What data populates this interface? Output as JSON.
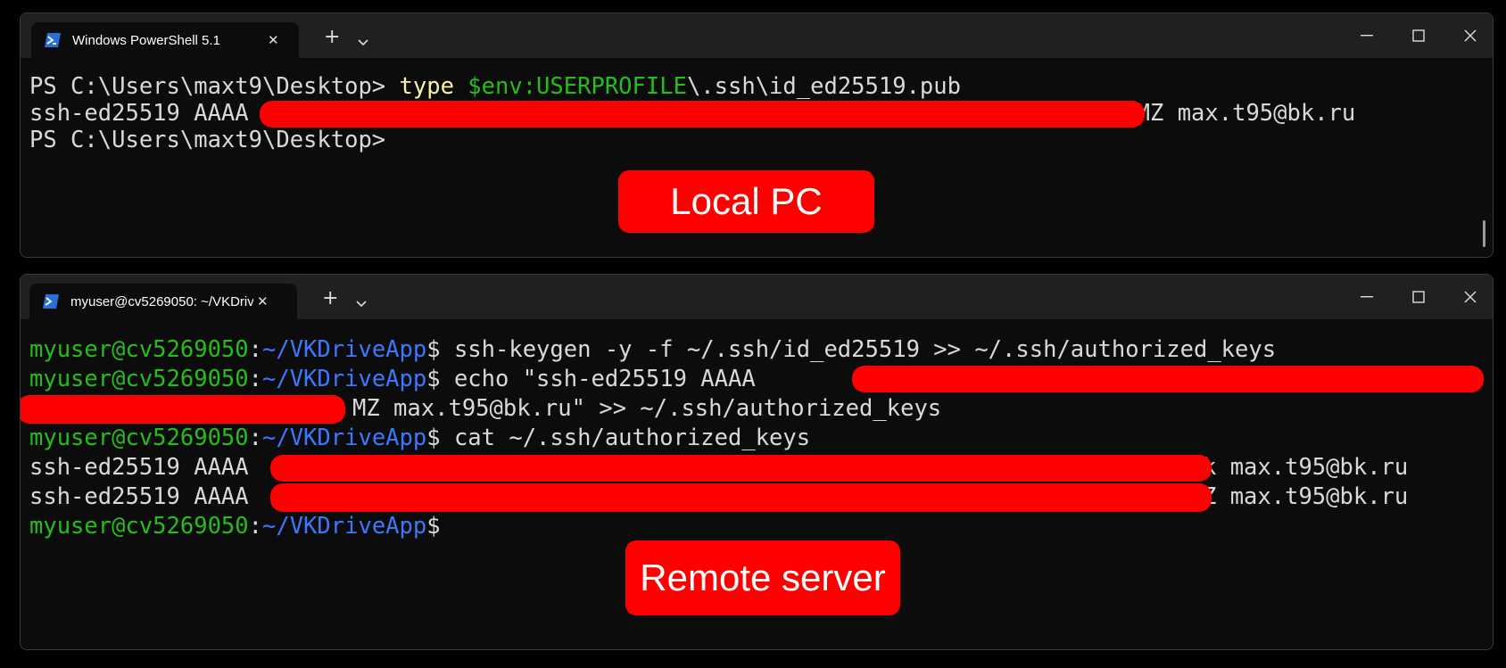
{
  "local_window": {
    "tab_title": "Windows PowerShell 5.1",
    "tab_icon": "powershell-icon",
    "lines": [
      {
        "prompt": "PS C:\\Users\\maxt9\\Desktop> ",
        "cmd": "type",
        "var": " $env:USERPROFILE",
        "rest": "\\.ssh\\id_ed25519.pub"
      },
      {
        "start": "ssh-ed25519 AAAA",
        "end": "MZ max.t95@bk.ru"
      },
      {
        "prompt": "PS C:\\Users\\maxt9\\Desktop>"
      }
    ],
    "label": "Local PC"
  },
  "remote_window": {
    "tab_title": "myuser@cv5269050: ~/VKDriveApp",
    "tab_icon": "terminal-penguin-icon",
    "user_host": "myuser@cv5269050",
    "sep": ":",
    "path": "~/VKDriveApp",
    "dollar": "$",
    "cmd1": " ssh-keygen -y -f ~/.ssh/id_ed25519 >> ~/.ssh/authorized_keys",
    "cmd2": " echo \"ssh-ed25519 AAAA",
    "cmd2_cont": "MZ max.t95@bk.ru\" >> ~/.ssh/authorized_keys",
    "cmd3": " cat ~/.ssh/authorized_keys",
    "key1_start": "ssh-ed25519 AAAA",
    "key1_end": "sk max.t95@bk.ru",
    "key2_start": "ssh-ed25519 AAAA",
    "key2_end": "MZ max.t95@bk.ru",
    "label": "Remote server"
  },
  "colors": {
    "terminal_bg": "#0c0c0c",
    "titlebar_bg": "#202020",
    "prompt_green": "#26bc1c",
    "path_blue": "#3b78ff",
    "ps_yellow": "#f9f1a5",
    "redaction_red": "#ff0000"
  }
}
